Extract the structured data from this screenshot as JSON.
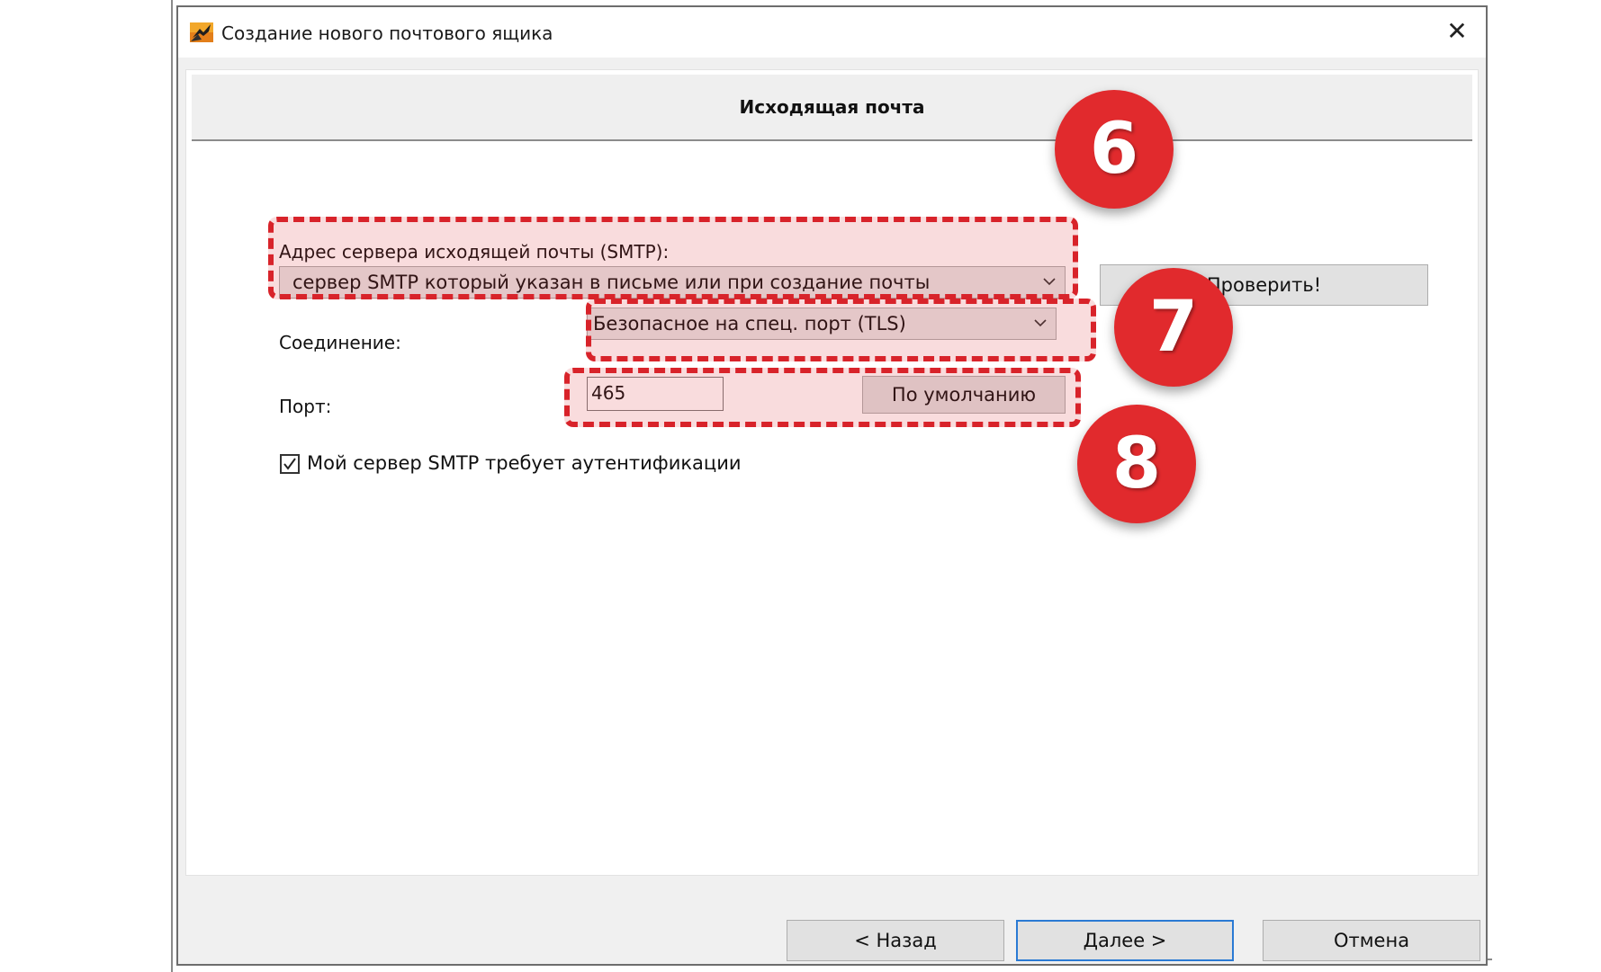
{
  "window": {
    "title": "Создание нового почтового ящика",
    "icon": "mail-app-icon",
    "close_symbol": "✕"
  },
  "page": {
    "header": "Исходящая почта"
  },
  "smtp": {
    "label": "Адрес сервера исходящей почты (SMTP):",
    "value": "сервер SMTP который указан в письме или при создание почты",
    "check_button": "Проверить!"
  },
  "connection": {
    "label": "Соединение:",
    "value": "Безопасное на спец. порт (TLS)"
  },
  "port": {
    "label": "Порт:",
    "value": "465",
    "default_button": "По умолчанию"
  },
  "auth": {
    "checked": true,
    "label": "Мой сервер SMTP требует аутентификации"
  },
  "footer": {
    "back": "<  Назад",
    "next": "Далее  >",
    "cancel": "Отмена"
  },
  "annotations": [
    "6",
    "7",
    "8"
  ],
  "colors": {
    "highlight": "#d8232a",
    "badge": "#e12a2d",
    "primary_border": "#2a7ad4"
  }
}
